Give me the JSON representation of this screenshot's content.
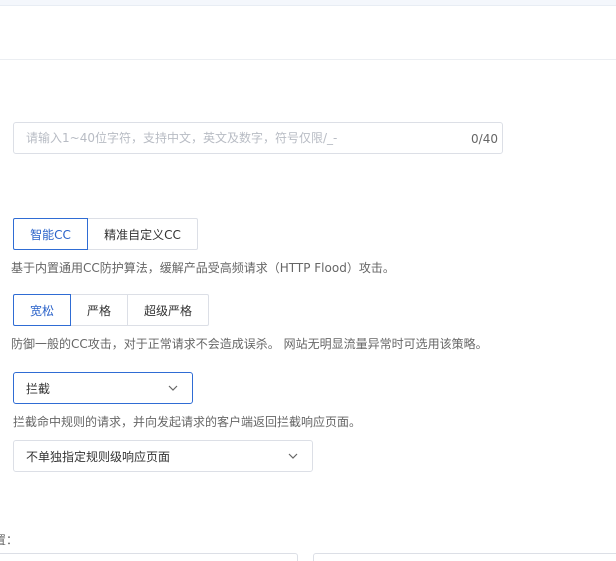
{
  "name_input": {
    "placeholder": "请输入1~40位字符，支持中文，英文及数字，符号仅限/_-",
    "value": "",
    "counter": "0/40"
  },
  "protection_mode": {
    "options": [
      "智能CC",
      "精准自定义CC"
    ],
    "selected": "智能CC",
    "description": "基于内置通用CC防护算法，缓解产品受高频请求（HTTP Flood）攻击。"
  },
  "protection_level": {
    "options": [
      "宽松",
      "严格",
      "超级严格"
    ],
    "selected": "宽松",
    "description": "防御一般的CC攻击，对于正常请求不会造成误杀。 网站无明显流量异常时可选用该策略。"
  },
  "action": {
    "selected": "拦截",
    "description": "拦截命中规则的请求，并向发起请求的客户端返回拦截响应页面。"
  },
  "response_page": {
    "selected": "不单独指定规则级响应页面"
  },
  "bottom": {
    "label": "置："
  },
  "icons": {
    "select_arrow": "chevron-down-icon"
  },
  "colors": {
    "accent": "#2f6cd4",
    "border": "#dcdfe6",
    "muted_text": "#666666",
    "placeholder": "#b8bcc4"
  }
}
